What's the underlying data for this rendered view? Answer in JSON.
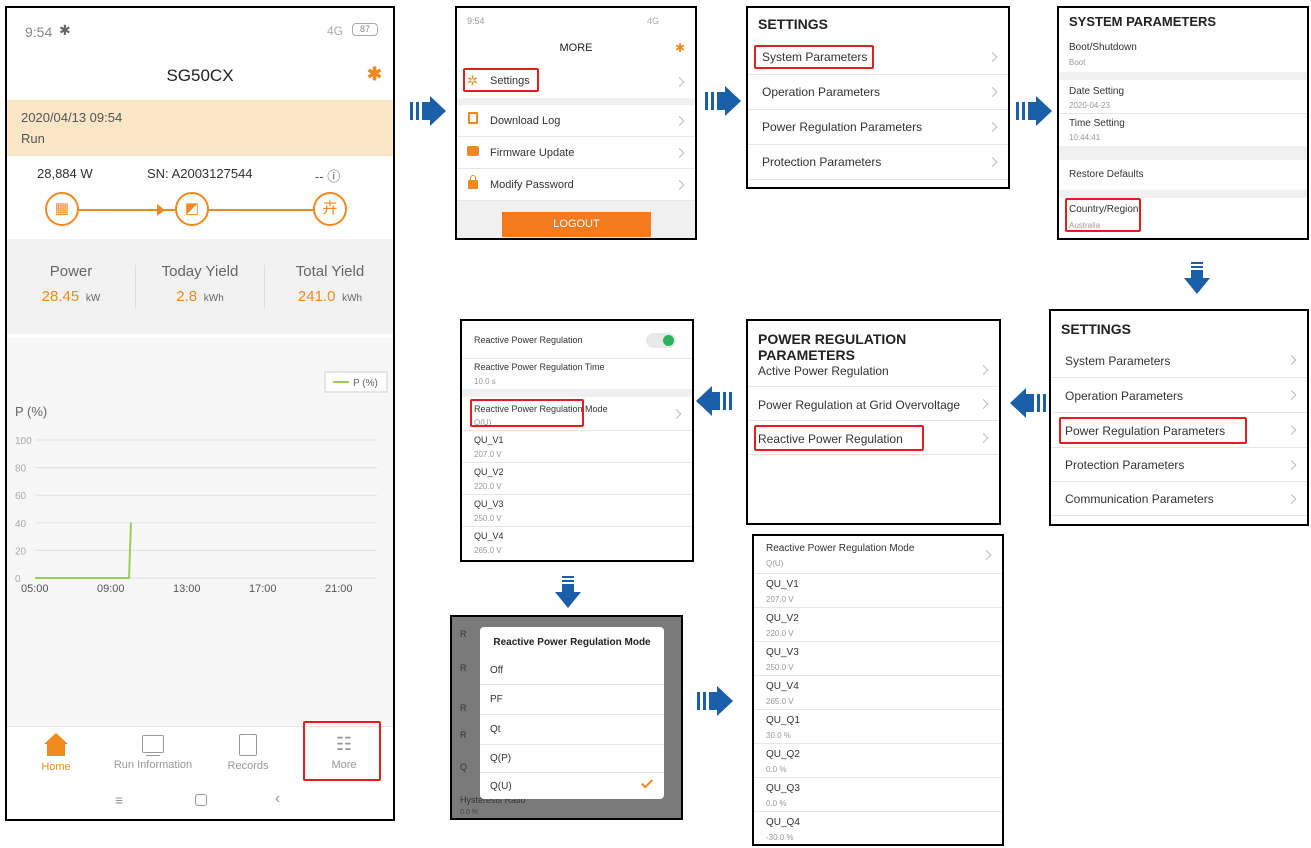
{
  "phone": {
    "status_time": "9:54",
    "status_right": "4G",
    "battery": "87",
    "title": "SG50CX",
    "date": "2020/04/13 09:54",
    "state": "Run",
    "power_w": "28,884  W",
    "sn": "SN: A2003127544",
    "dash": "-- ⓘ",
    "stats": [
      {
        "label": "Power",
        "value": "28.45",
        "unit": "kW"
      },
      {
        "label": "Today Yield",
        "value": "2.8",
        "unit": "kWh"
      },
      {
        "label": "Total Yield",
        "value": "241.0",
        "unit": "kWh"
      }
    ],
    "nav": [
      {
        "label": "Home"
      },
      {
        "label": "Run Information"
      },
      {
        "label": "Records"
      },
      {
        "label": "More"
      }
    ]
  },
  "chart_data": {
    "type": "line",
    "ylabel": "P (%)",
    "legend": "P (%)",
    "legend_position": "top-right",
    "yticks": [
      0,
      20,
      40,
      60,
      80,
      100
    ],
    "xticks": [
      "05:00",
      "09:00",
      "13:00",
      "17:00",
      "21:00"
    ],
    "ylim": [
      0,
      100
    ],
    "xlim": [
      5,
      23
    ],
    "grid": true,
    "series": [
      {
        "name": "P (%)",
        "color": "#9bcf53",
        "x": [
          5,
          9.6,
          9.95,
          10.05
        ],
        "y": [
          0,
          0,
          0,
          40
        ]
      }
    ]
  },
  "more": {
    "time": "9:54",
    "status_right": "4G",
    "title": "MORE",
    "items": [
      "Settings",
      "Download Log",
      "Firmware Update",
      "Modify Password"
    ],
    "logout": "LOGOUT"
  },
  "settings1": {
    "title": "SETTINGS",
    "items": [
      "System Parameters",
      "Operation Parameters",
      "Power Regulation Parameters",
      "Protection Parameters"
    ]
  },
  "sysparams": {
    "title": "SYSTEM PARAMETERS",
    "items": [
      {
        "t": "Boot/Shutdown",
        "s": "Boot"
      },
      {
        "t": "Date Setting",
        "s": "2020-04-23"
      },
      {
        "t": "Time Setting",
        "s": "10:44:41"
      },
      {
        "t": "Restore Defaults",
        "s": ""
      },
      {
        "t": "Country/Region",
        "s": "Australia"
      }
    ]
  },
  "settings2": {
    "title": "SETTINGS",
    "items": [
      "System Parameters",
      "Operation Parameters",
      "Power Regulation Parameters",
      "Protection Parameters",
      "Communication Parameters"
    ]
  },
  "powerreg": {
    "title": "POWER REGULATION PARAMETERS",
    "items": [
      "Active Power Regulation",
      "Power Regulation at Grid Overvoltage",
      "Reactive Power Regulation"
    ]
  },
  "reactive": {
    "items": [
      {
        "t": "Reactive Power Regulation",
        "s": ""
      },
      {
        "t": "Reactive Power Regulation Time",
        "s": "10.0 s"
      },
      {
        "t": "Reactive Power Regulation Mode",
        "s": "Q(U)"
      },
      {
        "t": "QU_V1",
        "s": "207.0 V"
      },
      {
        "t": "QU_V2",
        "s": "220.0 V"
      },
      {
        "t": "QU_V3",
        "s": "250.0 V"
      },
      {
        "t": "QU_V4",
        "s": "265.0 V"
      }
    ]
  },
  "modal": {
    "title": "Reactive Power Regulation Mode",
    "options": [
      "Off",
      "PF",
      "Qt",
      "Q(P)",
      "Q(U)"
    ],
    "selected": "Q(U)",
    "behind_label": "Hysteresis Ratio",
    "behind_value": "0.0 %"
  },
  "qu": {
    "items": [
      {
        "t": "Reactive Power Regulation Mode",
        "s": "Q(U)"
      },
      {
        "t": "QU_V1",
        "s": "207.0 V"
      },
      {
        "t": "QU_V2",
        "s": "220.0 V"
      },
      {
        "t": "QU_V3",
        "s": "250.0 V"
      },
      {
        "t": "QU_V4",
        "s": "265.0 V"
      },
      {
        "t": "QU_Q1",
        "s": "30.0 %"
      },
      {
        "t": "QU_Q2",
        "s": "0.0 %"
      },
      {
        "t": "QU_Q3",
        "s": "0.0 %"
      },
      {
        "t": "QU_Q4",
        "s": "-30.0 %"
      }
    ]
  },
  "colors": {
    "accent": "#f08a1e",
    "arrow": "#1a5fa8",
    "red": "#e02020",
    "green": "#9bcf53"
  }
}
